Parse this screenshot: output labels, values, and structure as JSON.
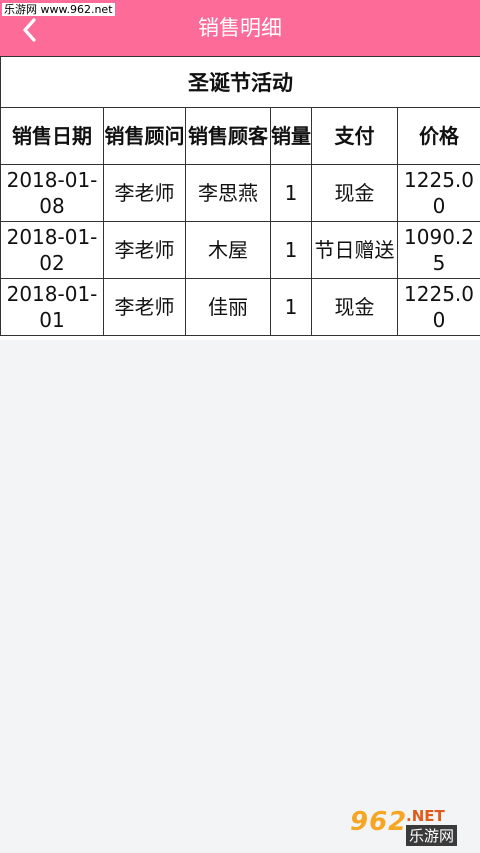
{
  "watermark_top": "乐游网 www.962.net",
  "header": {
    "title": "销售明细",
    "back_icon": "chevron-left-icon",
    "accent_color": "#fd6b98"
  },
  "table": {
    "caption": "圣诞节活动",
    "columns": [
      "销售日期",
      "销售顾问",
      "销售顾客",
      "销量",
      "支付",
      "价格"
    ],
    "rows": [
      [
        "2018-01-08",
        "李老师",
        "李思燕",
        "1",
        "现金",
        "1225.00"
      ],
      [
        "2018-01-02",
        "李老师",
        "木屋",
        "1",
        "节日赠送",
        "1090.25"
      ],
      [
        "2018-01-01",
        "李老师",
        "佳丽",
        "1",
        "现金",
        "1225.00"
      ]
    ]
  },
  "watermark_bottom": {
    "number": "962",
    "net": ".NET",
    "cn": "乐游网"
  }
}
